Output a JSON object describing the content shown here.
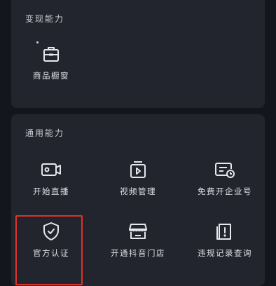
{
  "sections": {
    "monetize": {
      "title": "变现能力",
      "items": [
        {
          "label": "商品橱窗",
          "icon": "storefront-bag-icon"
        }
      ]
    },
    "general": {
      "title": "通用能力",
      "items": [
        {
          "label": "开始直播",
          "icon": "live-camera-icon"
        },
        {
          "label": "视频管理",
          "icon": "video-manage-icon"
        },
        {
          "label": "免费开企业号",
          "icon": "enterprise-account-icon"
        },
        {
          "label": "官方认证",
          "icon": "shield-check-icon"
        },
        {
          "label": "开通抖音门店",
          "icon": "store-awning-icon"
        },
        {
          "label": "违规记录查询",
          "icon": "violation-record-icon"
        }
      ]
    }
  },
  "colors": {
    "background": "#14161d",
    "card": "#22252d",
    "highlight": "#e0322a"
  }
}
